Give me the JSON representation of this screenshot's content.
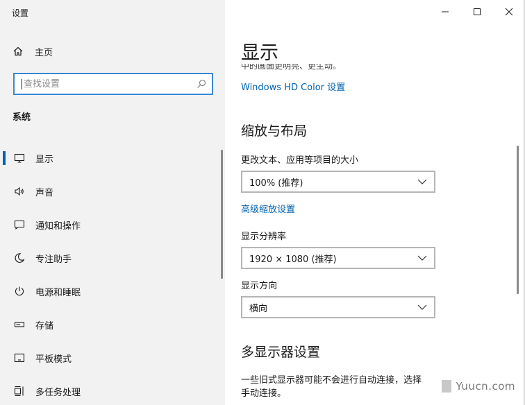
{
  "window": {
    "title": "设置"
  },
  "nav": {
    "home_label": "主页",
    "search_placeholder": "查找设置",
    "section_label": "系统",
    "items": [
      {
        "label": "显示",
        "icon": "monitor-icon",
        "active": true
      },
      {
        "label": "声音",
        "icon": "speaker-icon",
        "active": false
      },
      {
        "label": "通知和操作",
        "icon": "notification-icon",
        "active": false
      },
      {
        "label": "专注助手",
        "icon": "moon-icon",
        "active": false
      },
      {
        "label": "电源和睡眠",
        "icon": "power-icon",
        "active": false
      },
      {
        "label": "存储",
        "icon": "storage-icon",
        "active": false
      },
      {
        "label": "平板模式",
        "icon": "tablet-icon",
        "active": false
      },
      {
        "label": "多任务处理",
        "icon": "multitask-icon",
        "active": false
      }
    ]
  },
  "content": {
    "page_title": "显示",
    "cutoff_text": "中的画面更明亮、更生动。",
    "hdr_link": "Windows HD Color 设置",
    "scale_heading": "缩放与布局",
    "scale_label": "更改文本、应用等项目的大小",
    "scale_value": "100% (推荐)",
    "advanced_scale_link": "高级缩放设置",
    "resolution_label": "显示分辨率",
    "resolution_value": "1920 × 1080 (推荐)",
    "orientation_label": "显示方向",
    "orientation_value": "横向",
    "multi_heading": "多显示器设置",
    "multi_text": "一些旧式显示器可能不会进行自动连接，选择",
    "multi_text2": "手动连接。"
  },
  "watermark": {
    "text": "Yuucn.com"
  },
  "colors": {
    "accent": "#0063b1",
    "nav_bg": "#f2f2f2",
    "search_border": "#3a86d4"
  }
}
